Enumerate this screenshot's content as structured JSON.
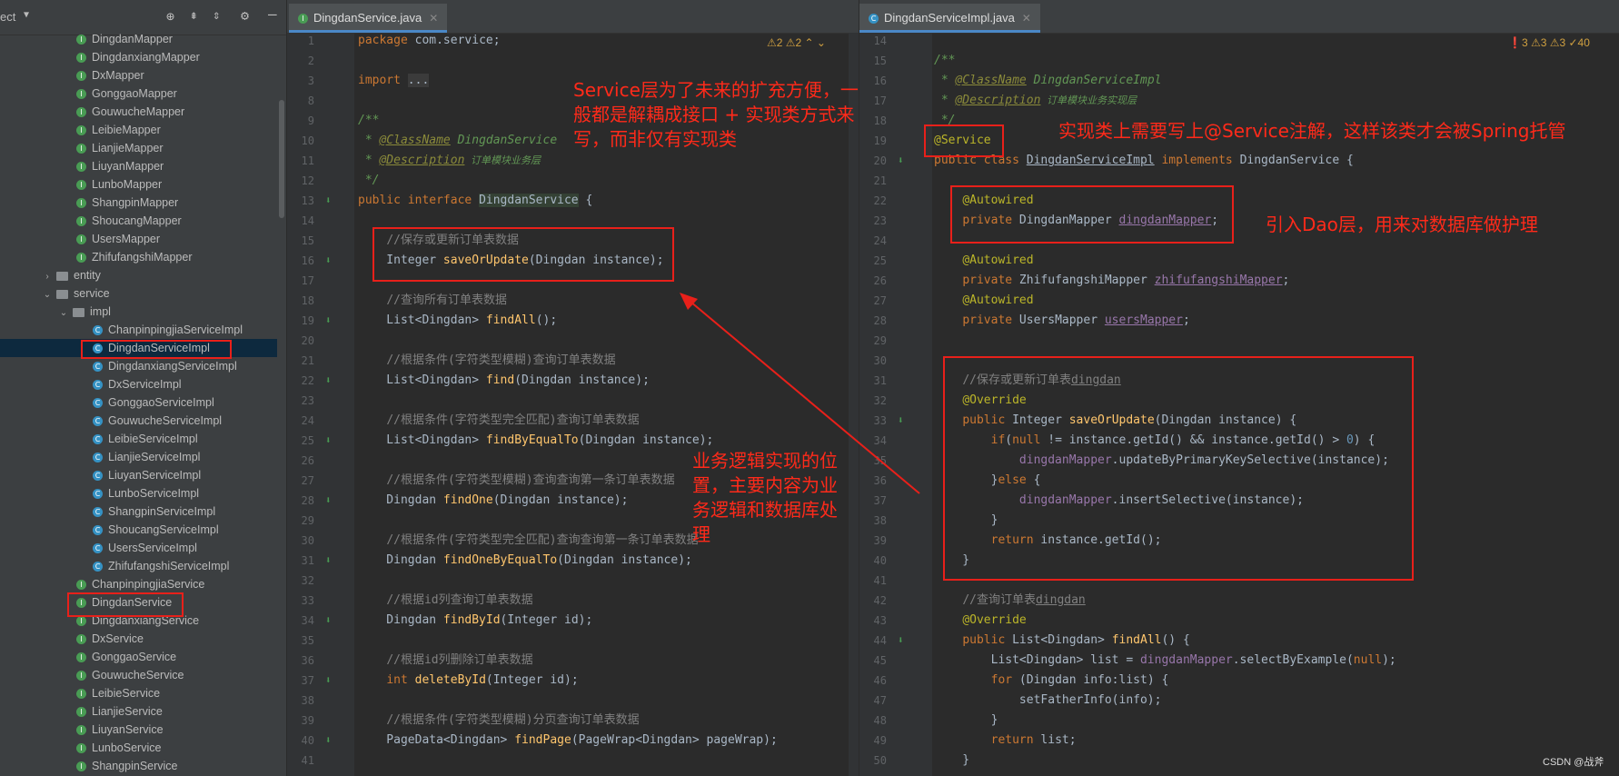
{
  "project": {
    "title": "ect",
    "tree": [
      {
        "label": "DingdanMapper",
        "kind": "i",
        "indent": 1
      },
      {
        "label": "DingdanxiangMapper",
        "kind": "i",
        "indent": 1
      },
      {
        "label": "DxMapper",
        "kind": "i",
        "indent": 1
      },
      {
        "label": "GonggaoMapper",
        "kind": "i",
        "indent": 1
      },
      {
        "label": "GouwucheMapper",
        "kind": "i",
        "indent": 1
      },
      {
        "label": "LeibieMapper",
        "kind": "i",
        "indent": 1
      },
      {
        "label": "LianjieMapper",
        "kind": "i",
        "indent": 1
      },
      {
        "label": "LiuyanMapper",
        "kind": "i",
        "indent": 1
      },
      {
        "label": "LunboMapper",
        "kind": "i",
        "indent": 1
      },
      {
        "label": "ShangpinMapper",
        "kind": "i",
        "indent": 1
      },
      {
        "label": "ShoucangMapper",
        "kind": "i",
        "indent": 1
      },
      {
        "label": "UsersMapper",
        "kind": "i",
        "indent": 1
      },
      {
        "label": "ZhifufangshiMapper",
        "kind": "i",
        "indent": 1
      },
      {
        "label": "entity",
        "kind": "folder",
        "indent": 0,
        "arrow": "›"
      },
      {
        "label": "service",
        "kind": "folder",
        "indent": 0,
        "arrow": "⌄"
      },
      {
        "label": "impl",
        "kind": "folder",
        "indent": 1,
        "arrow": "⌄"
      },
      {
        "label": "ChanpinpingjiaServiceImpl",
        "kind": "c",
        "indent": 2
      },
      {
        "label": "DingdanServiceImpl",
        "kind": "c",
        "indent": 2,
        "selected": true
      },
      {
        "label": "DingdanxiangServiceImpl",
        "kind": "c",
        "indent": 2
      },
      {
        "label": "DxServiceImpl",
        "kind": "c",
        "indent": 2
      },
      {
        "label": "GonggaoServiceImpl",
        "kind": "c",
        "indent": 2
      },
      {
        "label": "GouwucheServiceImpl",
        "kind": "c",
        "indent": 2
      },
      {
        "label": "LeibieServiceImpl",
        "kind": "c",
        "indent": 2
      },
      {
        "label": "LianjieServiceImpl",
        "kind": "c",
        "indent": 2
      },
      {
        "label": "LiuyanServiceImpl",
        "kind": "c",
        "indent": 2
      },
      {
        "label": "LunboServiceImpl",
        "kind": "c",
        "indent": 2
      },
      {
        "label": "ShangpinServiceImpl",
        "kind": "c",
        "indent": 2
      },
      {
        "label": "ShoucangServiceImpl",
        "kind": "c",
        "indent": 2
      },
      {
        "label": "UsersServiceImpl",
        "kind": "c",
        "indent": 2
      },
      {
        "label": "ZhifufangshiServiceImpl",
        "kind": "c",
        "indent": 2
      },
      {
        "label": "ChanpinpingjiaService",
        "kind": "i",
        "indent": 1
      },
      {
        "label": "DingdanService",
        "kind": "i",
        "indent": 1
      },
      {
        "label": "DingdanxiangService",
        "kind": "i",
        "indent": 1
      },
      {
        "label": "DxService",
        "kind": "i",
        "indent": 1
      },
      {
        "label": "GonggaoService",
        "kind": "i",
        "indent": 1
      },
      {
        "label": "GouwucheService",
        "kind": "i",
        "indent": 1
      },
      {
        "label": "LeibieService",
        "kind": "i",
        "indent": 1
      },
      {
        "label": "LianjieService",
        "kind": "i",
        "indent": 1
      },
      {
        "label": "LiuyanService",
        "kind": "i",
        "indent": 1
      },
      {
        "label": "LunboService",
        "kind": "i",
        "indent": 1
      },
      {
        "label": "ShangpinService",
        "kind": "i",
        "indent": 1
      }
    ]
  },
  "left_editor": {
    "tab_label": "DingdanService.java",
    "inspections": "⚠2  ⚠2  ⌃ ⌄",
    "lines": [
      {
        "n": "1",
        "html": "<span class='kw'>package</span> com.service;"
      },
      {
        "n": "2",
        "html": ""
      },
      {
        "n": "3",
        "html": "<span class='kw'>import</span> <span style='background:#3b3b3b'>...</span>"
      },
      {
        "n": "8",
        "html": ""
      },
      {
        "n": "9",
        "html": "<span class='doc'>/**</span>"
      },
      {
        "n": "10",
        "html": "<span class='doc'> * </span><span class='doc ul' style='color:#8a8a3a'>@ClassName</span><span class='doc'> DingdanService</span>"
      },
      {
        "n": "11",
        "html": "<span class='doc'> * </span><span class='doc ul' style='color:#8a8a3a'>@Description</span><span class='doc' style='font-size:11px'> 订单模块业务层</span>"
      },
      {
        "n": "12",
        "html": "<span class='doc'> */</span>"
      },
      {
        "n": "13",
        "html": "<span class='kw'>public interface</span> <span style='background:#344134'>DingdanService</span> {"
      },
      {
        "n": "14",
        "html": ""
      },
      {
        "n": "15",
        "html": "    <span class='cm'>//保存或更新订单表数据</span>"
      },
      {
        "n": "16",
        "html": "    Integer <span class='fn'>saveOrUpdate</span>(Dingdan instance);"
      },
      {
        "n": "17",
        "html": ""
      },
      {
        "n": "18",
        "html": "    <span class='cm'>//查询所有订单表数据</span>"
      },
      {
        "n": "19",
        "html": "    List&lt;Dingdan&gt; <span class='fn'>findAll</span>();"
      },
      {
        "n": "20",
        "html": ""
      },
      {
        "n": "21",
        "html": "    <span class='cm'>//根据条件(字符类型模糊)查询订单表数据</span>"
      },
      {
        "n": "22",
        "html": "    List&lt;Dingdan&gt; <span class='fn'>find</span>(Dingdan instance);"
      },
      {
        "n": "23",
        "html": ""
      },
      {
        "n": "24",
        "html": "    <span class='cm'>//根据条件(字符类型完全匹配)查询订单表数据</span>"
      },
      {
        "n": "25",
        "html": "    List&lt;Dingdan&gt; <span class='fn'>findByEqualTo</span>(Dingdan instance);"
      },
      {
        "n": "26",
        "html": ""
      },
      {
        "n": "27",
        "html": "    <span class='cm'>//根据条件(字符类型模糊)查询查询第一条订单表数据</span>"
      },
      {
        "n": "28",
        "html": "    Dingdan <span class='fn'>findOne</span>(Dingdan instance);"
      },
      {
        "n": "29",
        "html": ""
      },
      {
        "n": "30",
        "html": "    <span class='cm'>//根据条件(字符类型完全匹配)查询查询第一条订单表数据</span>"
      },
      {
        "n": "31",
        "html": "    Dingdan <span class='fn'>findOneByEqualTo</span>(Dingdan instance);"
      },
      {
        "n": "32",
        "html": ""
      },
      {
        "n": "33",
        "html": "    <span class='cm'>//根据id列查询订单表数据</span>"
      },
      {
        "n": "34",
        "html": "    Dingdan <span class='fn'>findById</span>(Integer id);"
      },
      {
        "n": "35",
        "html": ""
      },
      {
        "n": "36",
        "html": "    <span class='cm'>//根据id列删除订单表数据</span>"
      },
      {
        "n": "37",
        "html": "    <span class='kw'>int</span> <span class='fn'>deleteById</span>(Integer id);"
      },
      {
        "n": "38",
        "html": ""
      },
      {
        "n": "39",
        "html": "    <span class='cm'>//根据条件(字符类型模糊)分页查询订单表数据</span>"
      },
      {
        "n": "40",
        "html": "    PageData&lt;Dingdan&gt; <span class='fn'>findPage</span>(PageWrap&lt;Dingdan&gt; pageWrap);"
      },
      {
        "n": "41",
        "html": ""
      }
    ]
  },
  "right_editor": {
    "tab_label": "DingdanServiceImpl.java",
    "inspections": "❗3  ⚠3  ⚠3  ✓40",
    "lines": [
      {
        "n": "14",
        "html": ""
      },
      {
        "n": "15",
        "html": "<span class='doc'>/**</span>"
      },
      {
        "n": "16",
        "html": "<span class='doc'> * </span><span class='doc ul' style='color:#8a8a3a'>@ClassName</span><span class='doc'> DingdanServiceImpl</span>"
      },
      {
        "n": "17",
        "html": "<span class='doc'> * </span><span class='doc ul' style='color:#8a8a3a'>@Description</span><span class='doc' style='font-size:11px'> 订单模块业务实现层</span>"
      },
      {
        "n": "18",
        "html": "<span class='doc'> */</span>"
      },
      {
        "n": "19",
        "html": "<span class='ann'>@Service</span>"
      },
      {
        "n": "20",
        "html": "<span class='kw'>public class</span> <span class='ul'>DingdanServiceImpl</span> <span class='kw'>implements</span> DingdanService {"
      },
      {
        "n": "21",
        "html": ""
      },
      {
        "n": "22",
        "html": "    <span class='ann'>@Autowired</span>"
      },
      {
        "n": "23",
        "html": "    <span class='kw'>private</span> DingdanMapper <span class='field ul'>dingdanMapper</span>;"
      },
      {
        "n": "24",
        "html": ""
      },
      {
        "n": "25",
        "html": "    <span class='ann'>@Autowired</span>"
      },
      {
        "n": "26",
        "html": "    <span class='kw'>private</span> ZhifufangshiMapper <span class='field ul'>zhifufangshiMapper</span>;"
      },
      {
        "n": "27",
        "html": "    <span class='ann'>@Autowired</span>"
      },
      {
        "n": "28",
        "html": "    <span class='kw'>private</span> UsersMapper <span class='field ul'>usersMapper</span>;"
      },
      {
        "n": "29",
        "html": ""
      },
      {
        "n": "30",
        "html": ""
      },
      {
        "n": "31",
        "html": "    <span class='cm'>//保存或更新订单表<span class='ul'>dingdan</span></span>"
      },
      {
        "n": "32",
        "html": "    <span class='ann'>@Override</span>"
      },
      {
        "n": "33",
        "html": "    <span class='kw'>public</span> Integer <span class='fn'>saveOrUpdate</span>(Dingdan instance) {"
      },
      {
        "n": "34",
        "html": "        <span class='kw'>if</span>(<span class='kw'>null</span> != instance.getId() &amp;&amp; instance.getId() &gt; <span class='num'>0</span>) {"
      },
      {
        "n": "35",
        "html": "            <span class='field'>dingdanMapper</span>.updateByPrimaryKeySelective(instance);"
      },
      {
        "n": "36",
        "html": "        }<span class='kw'>else</span> {"
      },
      {
        "n": "37",
        "html": "            <span class='field'>dingdanMapper</span>.insertSelective(instance);"
      },
      {
        "n": "38",
        "html": "        }"
      },
      {
        "n": "39",
        "html": "        <span class='kw'>return</span> instance.getId();"
      },
      {
        "n": "40",
        "html": "    }"
      },
      {
        "n": "41",
        "html": ""
      },
      {
        "n": "42",
        "html": "    <span class='cm'>//查询订单表<span class='ul'>dingdan</span></span>"
      },
      {
        "n": "43",
        "html": "    <span class='ann'>@Override</span>"
      },
      {
        "n": "44",
        "html": "    <span class='kw'>public</span> List&lt;Dingdan&gt; <span class='fn'>findAll</span>() {"
      },
      {
        "n": "45",
        "html": "        List&lt;Dingdan&gt; list = <span class='field'>dingdanMapper</span>.selectByExample(<span class='kw'>null</span>);"
      },
      {
        "n": "46",
        "html": "        <span class='kw'>for</span> (Dingdan info:list) {"
      },
      {
        "n": "47",
        "html": "            setFatherInfo(info);"
      },
      {
        "n": "48",
        "html": "        }"
      },
      {
        "n": "49",
        "html": "        <span class='kw'>return</span> list;"
      },
      {
        "n": "50",
        "html": "    }"
      }
    ]
  },
  "annotations": {
    "service_layer_note": "Service层为了未来的扩充方便，一般都是解耦成接口 + 实现类方式来写，而非仅有实现类",
    "service_anno_note": "实现类上需要写上@Service注解，这样该类才会被Spring托管",
    "dao_note": "引入Dao层，用来对数据库做护理",
    "logic_note": "业务逻辑实现的位置，主要内容为业务逻辑和数据库处理"
  },
  "watermark": "CSDN @战斧",
  "colors": {
    "annotation_red": "#e8201a",
    "selection": "#0d293e",
    "accent_tab": "#4a88c7"
  }
}
